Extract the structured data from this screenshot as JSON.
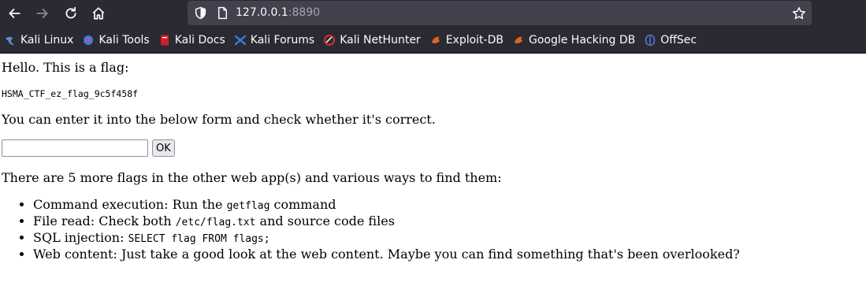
{
  "browser": {
    "url_host": "127.0.0.1",
    "url_port": ":8890",
    "bookmarks": [
      {
        "label": "Kali Linux",
        "icon": "kali-dragon-icon",
        "color": "#5a8fc8"
      },
      {
        "label": "Kali Tools",
        "icon": "kali-tools-icon",
        "color": "#e05050"
      },
      {
        "label": "Kali Docs",
        "icon": "kali-docs-icon",
        "color": "#d01f2e"
      },
      {
        "label": "Kali Forums",
        "icon": "kali-forums-icon",
        "color": "#3b7ddd"
      },
      {
        "label": "Kali NetHunter",
        "icon": "kali-nethunter-icon",
        "color": "#d0302e"
      },
      {
        "label": "Exploit-DB",
        "icon": "exploit-db-icon",
        "color": "#e3641d"
      },
      {
        "label": "Google Hacking DB",
        "icon": "ghdb-icon",
        "color": "#e3641d"
      },
      {
        "label": "OffSec",
        "icon": "offsec-icon",
        "color": "#5b6fd6"
      }
    ]
  },
  "page": {
    "greeting": "Hello. This is a flag:",
    "flag": "HSMA_CTF_ez_flag_9c5f458f",
    "enter_text": "You can enter it into the below form and check whether it's correct.",
    "form": {
      "input_value": "",
      "ok_label": "OK"
    },
    "more_text": "There are 5 more flags in the other web app(s) and various ways to find them:",
    "hints": [
      {
        "before": "Command execution: Run the ",
        "code": "getflag",
        "after": " command"
      },
      {
        "before": "File read: Check both ",
        "code": "/etc/flag.txt",
        "after": " and source code files"
      },
      {
        "before": "SQL injection: ",
        "code": "SELECT flag FROM flags;",
        "after": ""
      },
      {
        "before": "Web content: Just take a good look at the web content. Maybe you can find something that's been overlooked?",
        "code": "",
        "after": ""
      }
    ]
  }
}
